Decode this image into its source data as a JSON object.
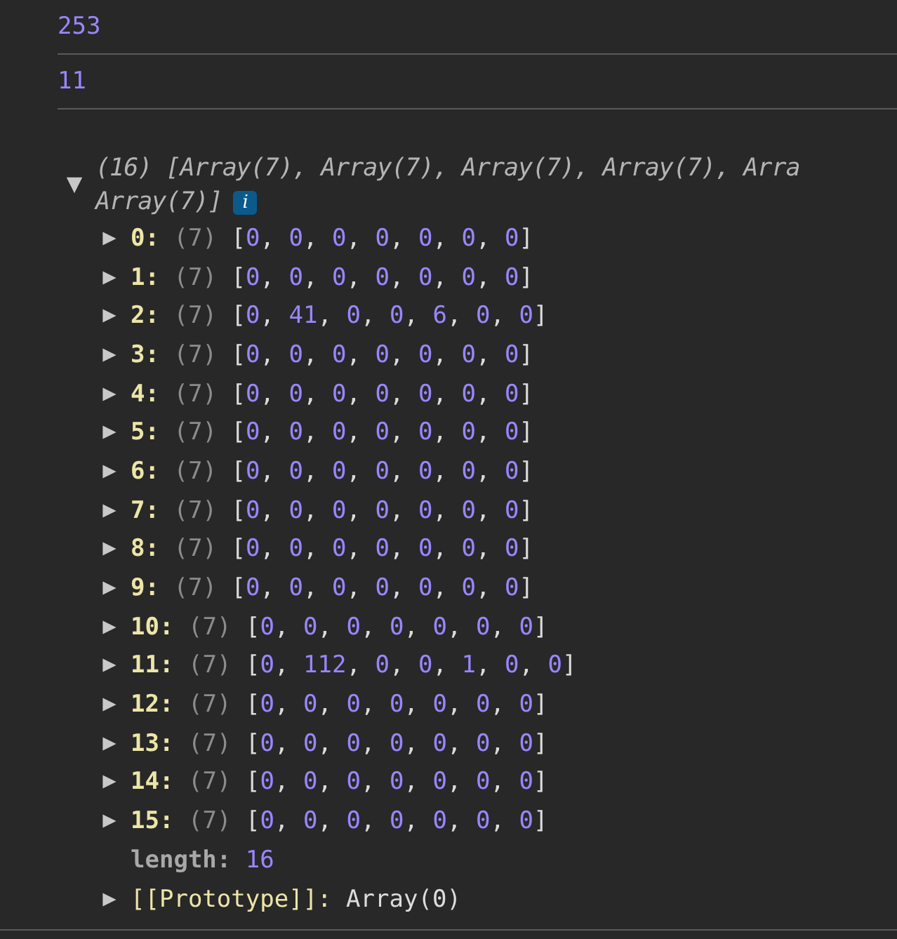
{
  "log_lines": [
    "253",
    "11"
  ],
  "array_entry": {
    "expanded": true,
    "summary_lines": [
      "(16) [Array(7), Array(7), Array(7), Array(7), Arra",
      "Array(7)]"
    ],
    "info_badge": "i",
    "rows": [
      {
        "index": "0:",
        "count": "(7)",
        "value": "[0, 0, 0, 0, 0, 0, 0]",
        "expanded": false
      },
      {
        "index": "1:",
        "count": "(7)",
        "value": "[0, 0, 0, 0, 0, 0, 0]",
        "expanded": false
      },
      {
        "index": "2:",
        "count": "(7)",
        "value": "[0, 41, 0, 0, 6, 0, 0]",
        "expanded": false
      },
      {
        "index": "3:",
        "count": "(7)",
        "value": "[0, 0, 0, 0, 0, 0, 0]",
        "expanded": false
      },
      {
        "index": "4:",
        "count": "(7)",
        "value": "[0, 0, 0, 0, 0, 0, 0]",
        "expanded": false
      },
      {
        "index": "5:",
        "count": "(7)",
        "value": "[0, 0, 0, 0, 0, 0, 0]",
        "expanded": false
      },
      {
        "index": "6:",
        "count": "(7)",
        "value": "[0, 0, 0, 0, 0, 0, 0]",
        "expanded": false
      },
      {
        "index": "7:",
        "count": "(7)",
        "value": "[0, 0, 0, 0, 0, 0, 0]",
        "expanded": false
      },
      {
        "index": "8:",
        "count": "(7)",
        "value": "[0, 0, 0, 0, 0, 0, 0]",
        "expanded": false
      },
      {
        "index": "9:",
        "count": "(7)",
        "value": "[0, 0, 0, 0, 0, 0, 0]",
        "expanded": false
      },
      {
        "index": "10:",
        "count": "(7)",
        "value": "[0, 0, 0, 0, 0, 0, 0]",
        "expanded": false
      },
      {
        "index": "11:",
        "count": "(7)",
        "value": "[0, 112, 0, 0, 1, 0, 0]",
        "expanded": false
      },
      {
        "index": "12:",
        "count": "(7)",
        "value": "[0, 0, 0, 0, 0, 0, 0]",
        "expanded": false
      },
      {
        "index": "13:",
        "count": "(7)",
        "value": "[0, 0, 0, 0, 0, 0, 0]",
        "expanded": false
      },
      {
        "index": "14:",
        "count": "(7)",
        "value": "[0, 0, 0, 0, 0, 0, 0]",
        "expanded": false
      },
      {
        "index": "15:",
        "count": "(7)",
        "value": "[0, 0, 0, 0, 0, 0, 0]",
        "expanded": false
      }
    ],
    "length": {
      "key": "length:",
      "value": "16"
    },
    "prototype": {
      "key": "[[Prototype]]:",
      "value": "Array(0)",
      "expanded": false
    }
  }
}
